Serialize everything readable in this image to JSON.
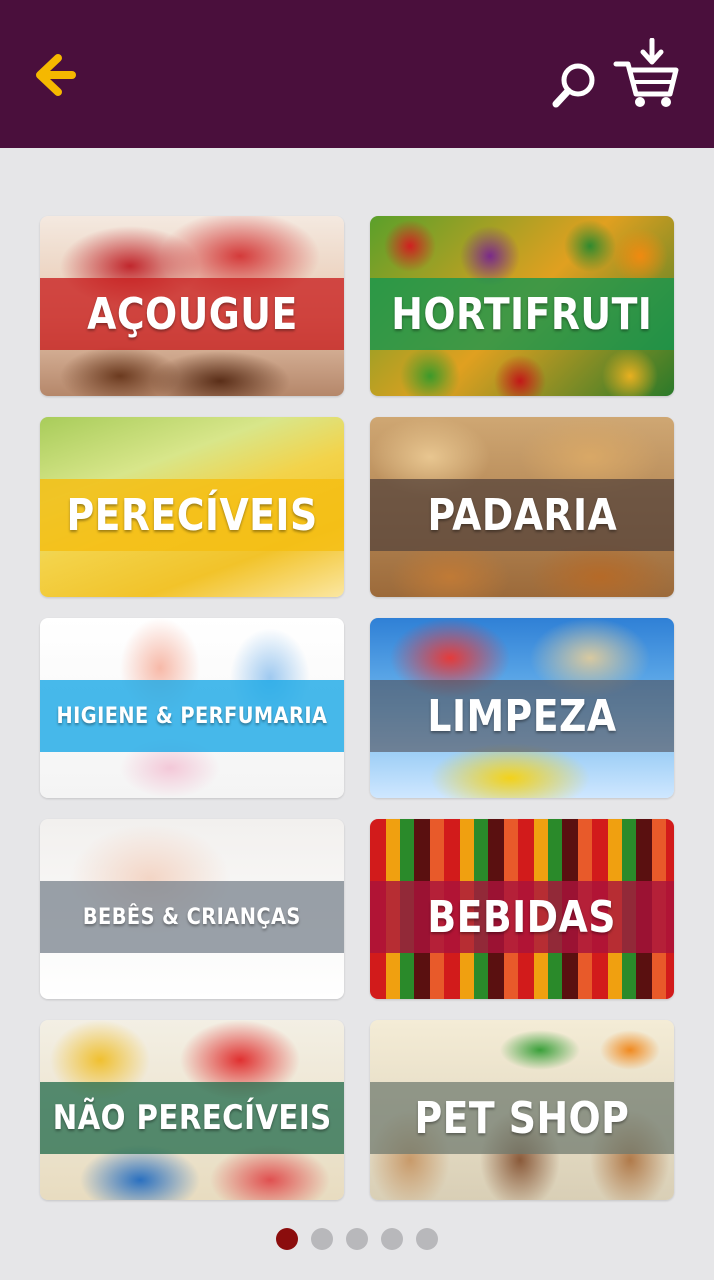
{
  "header": {
    "back_icon": "arrow-left-icon",
    "search_icon": "search-icon",
    "cart_icon": "cart-download-icon",
    "background": "#4a0f3c",
    "accent": "#f5b800"
  },
  "categories": [
    {
      "label": "AÇOUGUE"
    },
    {
      "label": "HORTIFRUTI"
    },
    {
      "label": "PERECÍVEIS"
    },
    {
      "label": "PADARIA"
    },
    {
      "label": "HIGIENE & PERFUMARIA"
    },
    {
      "label": "LIMPEZA"
    },
    {
      "label": "BEBÊS & CRIANÇAS"
    },
    {
      "label": "BEBIDAS"
    },
    {
      "label": "NÃO PERECÍVEIS"
    },
    {
      "label": "PET SHOP"
    }
  ],
  "pagination": {
    "total_pages": 5,
    "current_page": 1,
    "active_color": "#8b0d0d"
  }
}
